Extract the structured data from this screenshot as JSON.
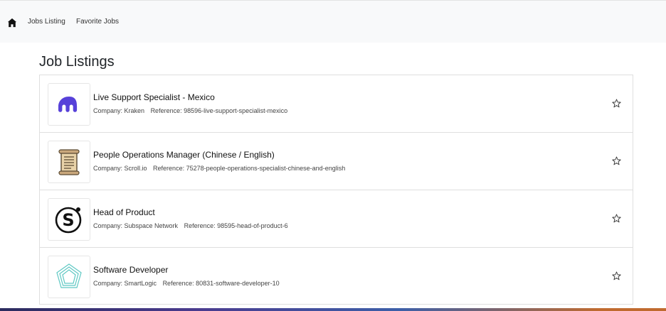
{
  "nav": {
    "home_icon": "home-icon",
    "links": [
      "Jobs Listing",
      "Favorite Jobs"
    ]
  },
  "page": {
    "title": "Job Listings"
  },
  "jobs": [
    {
      "title": "Live Support Specialist - Mexico",
      "company": "Company: Kraken",
      "reference": "Reference: 98596-live-support-specialist-mexico",
      "logo": "kraken-logo",
      "logo_color": "#5741d9"
    },
    {
      "title": "People Operations Manager (Chinese / English)",
      "company": "Company: Scroll.io",
      "reference": "Reference: 75278-people-operations-specialist-chinese-and-english",
      "logo": "scroll-logo",
      "logo_color": "#c9a77c"
    },
    {
      "title": "Head of Product",
      "company": "Company: Subspace Network",
      "reference": "Reference: 98595-head-of-product-6",
      "logo": "subspace-logo",
      "logo_color": "#111111"
    },
    {
      "title": "Software Developer",
      "company": "Company: SmartLogic",
      "reference": "Reference: 80831-software-developer-10",
      "logo": "smartlogic-logo",
      "logo_color": "#5ec8c3"
    }
  ],
  "favorite_icon": "star-outline-icon"
}
